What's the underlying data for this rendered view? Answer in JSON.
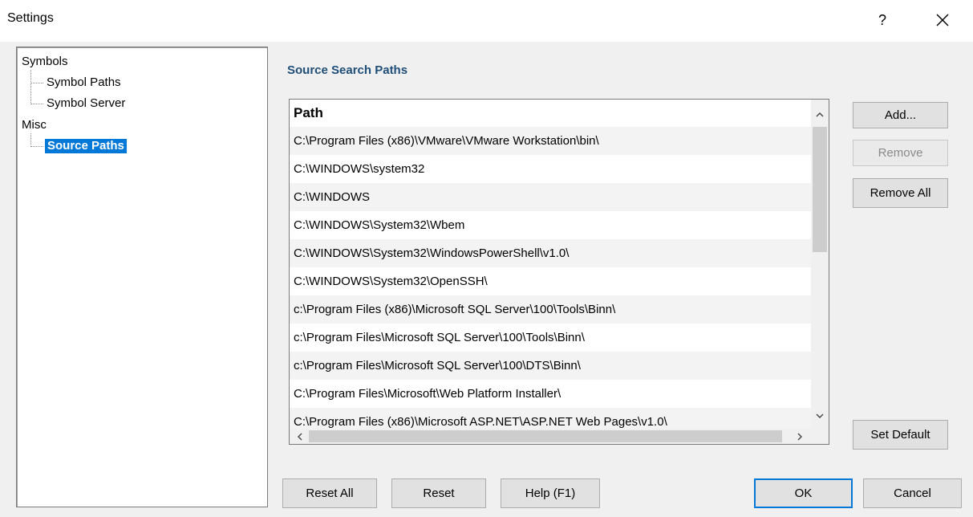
{
  "window": {
    "title": "Settings",
    "help_glyph": "?",
    "close_icon": "close-icon"
  },
  "tree": {
    "groups": [
      {
        "label": "Symbols",
        "children": [
          "Symbol Paths",
          "Symbol Server"
        ]
      },
      {
        "label": "Misc",
        "children": [
          "Source Paths"
        ]
      }
    ],
    "selected": "Source Paths"
  },
  "section_heading": "Source Search Paths",
  "list": {
    "column_header": "Path",
    "rows": [
      "C:\\Program Files (x86)\\VMware\\VMware Workstation\\bin\\",
      "C:\\WINDOWS\\system32",
      "C:\\WINDOWS",
      "C:\\WINDOWS\\System32\\Wbem",
      "C:\\WINDOWS\\System32\\WindowsPowerShell\\v1.0\\",
      "C:\\WINDOWS\\System32\\OpenSSH\\",
      "c:\\Program Files (x86)\\Microsoft SQL Server\\100\\Tools\\Binn\\",
      "c:\\Program Files\\Microsoft SQL Server\\100\\Tools\\Binn\\",
      "c:\\Program Files\\Microsoft SQL Server\\100\\DTS\\Binn\\",
      "C:\\Program Files\\Microsoft\\Web Platform Installer\\",
      "C:\\Program Files (x86)\\Microsoft ASP.NET\\ASP.NET Web Pages\\v1.0\\"
    ]
  },
  "side_buttons": {
    "add": "Add...",
    "remove": "Remove",
    "remove_all": "Remove All",
    "set_default": "Set Default"
  },
  "bottom_buttons": {
    "reset_all": "Reset All",
    "reset": "Reset",
    "help": "Help (F1)",
    "ok": "OK",
    "cancel": "Cancel"
  },
  "colors": {
    "selection": "#0078d7",
    "heading": "#1f4e79"
  }
}
